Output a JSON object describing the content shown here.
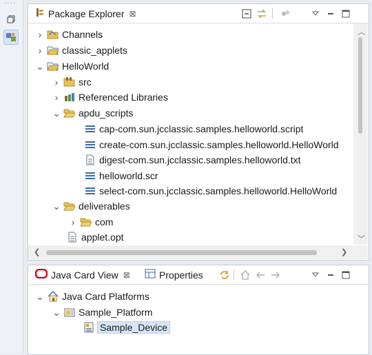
{
  "package_explorer": {
    "title": "Package Explorer",
    "tab_close": "⊠",
    "tree": [
      {
        "label": "Channels",
        "expanded": false,
        "icon": "channels-folder-icon"
      },
      {
        "label": "classic_applets",
        "expanded": false,
        "icon": "project-folder-icon"
      },
      {
        "label": "HelloWorld",
        "expanded": true,
        "icon": "project-folder-icon"
      },
      {
        "label": "src",
        "expanded": false,
        "icon": "source-folder-icon"
      },
      {
        "label": "Referenced Libraries",
        "expanded": false,
        "icon": "libraries-icon"
      },
      {
        "label": "apdu_scripts",
        "expanded": true,
        "icon": "folder-icon"
      },
      {
        "label": "cap-com.sun.jcclassic.samples.helloworld.script",
        "icon": "script-file-icon"
      },
      {
        "label": "create-com.sun.jcclassic.samples.helloworld.HelloWorld",
        "icon": "script-file-icon"
      },
      {
        "label": "digest-com.sun.jcclassic.samples.helloworld.txt",
        "icon": "text-file-icon"
      },
      {
        "label": "helloworld.scr",
        "icon": "script-file-icon"
      },
      {
        "label": "select-com.sun.jcclassic.samples.helloworld.HelloWorld",
        "icon": "script-file-icon"
      },
      {
        "label": "deliverables",
        "expanded": true,
        "icon": "folder-icon"
      },
      {
        "label": "com",
        "expanded": false,
        "icon": "folder-icon"
      },
      {
        "label": "applet.opt",
        "icon": "text-file-icon"
      }
    ]
  },
  "java_card_view": {
    "tabs": [
      {
        "label": "Java Card View",
        "close": "⊠"
      },
      {
        "label": "Properties"
      }
    ],
    "tree": [
      {
        "label": "Java Card Platforms",
        "expanded": true
      },
      {
        "label": "Sample_Platform",
        "expanded": true
      },
      {
        "label": "Sample_Device",
        "selected": true
      }
    ]
  },
  "colors": {
    "accent": "#d5e6f7",
    "folder": "#e8c15a",
    "java_card_logo": "#d0021b"
  }
}
